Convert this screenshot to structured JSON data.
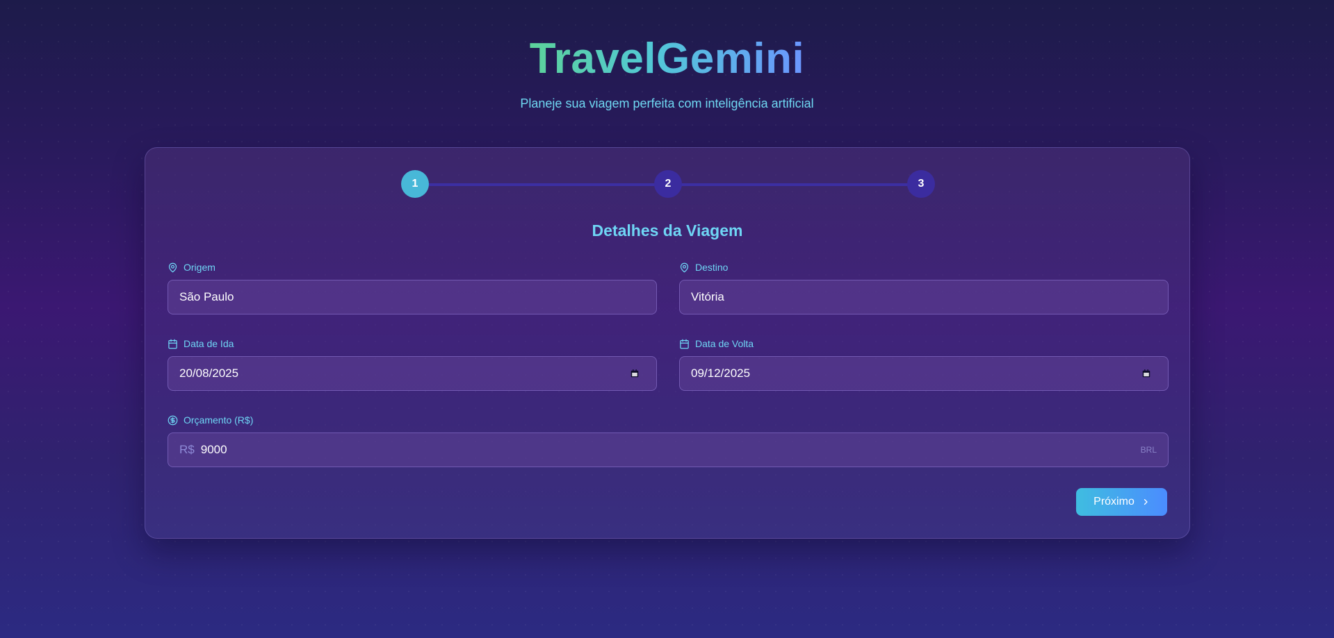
{
  "header": {
    "title": "TravelGemini",
    "subtitle": "Planeje sua viagem perfeita com inteligência artificial"
  },
  "stepper": {
    "current_step": 1,
    "steps": [
      "1",
      "2",
      "3"
    ]
  },
  "form": {
    "section_title": "Detalhes da Viagem",
    "origin": {
      "label": "Origem",
      "value": "São Paulo",
      "icon": "map-pin-icon"
    },
    "destination": {
      "label": "Destino",
      "value": "Vitória",
      "icon": "map-pin-icon"
    },
    "departure_date": {
      "label": "Data de Ida",
      "value": "20/08/2025",
      "icon": "calendar-icon"
    },
    "return_date": {
      "label": "Data de Volta",
      "value": "09/12/2025",
      "icon": "calendar-icon"
    },
    "budget": {
      "label": "Orçamento (R$)",
      "prefix": "R$",
      "value": "9000",
      "suffix": "BRL",
      "icon": "dollar-circle-icon"
    }
  },
  "actions": {
    "next_label": "Próximo"
  },
  "colors": {
    "accent": "#6fd6f5",
    "step_active": "#48b8d8",
    "step_inactive": "#3b2c9f",
    "button_gradient_start": "#3fbde0",
    "button_gradient_end": "#4b8cff"
  }
}
